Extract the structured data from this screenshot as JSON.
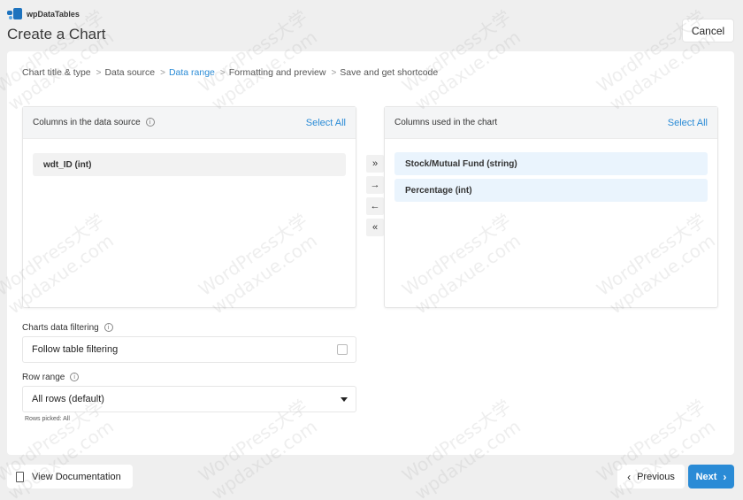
{
  "app": {
    "logo_text": "wpDataTables",
    "title": "Create a Chart"
  },
  "header": {
    "cancel_label": "Cancel"
  },
  "steps": [
    {
      "label": "Chart title & type"
    },
    {
      "label": "Data source"
    },
    {
      "label": "Data range"
    },
    {
      "label": "Formatting and preview"
    },
    {
      "label": "Save and get shortcode"
    }
  ],
  "active_step": "Data range",
  "source_panel": {
    "title": "Columns in the data source",
    "select_all": "Select All",
    "columns": [
      "wdt_ID (int)"
    ]
  },
  "chart_panel": {
    "title": "Columns used in the chart",
    "select_all": "Select All",
    "columns": [
      "Stock/Mutual Fund (string)",
      "Percentage (int)"
    ]
  },
  "transfer_buttons": {
    "add_all": "»",
    "add": "→",
    "remove": "←",
    "remove_all": "«"
  },
  "filtering": {
    "label": "Charts data filtering",
    "option": "Follow table filtering",
    "checked": false
  },
  "row_range": {
    "label": "Row range",
    "selected": "All rows (default)",
    "hint": "Rows picked: All"
  },
  "footer": {
    "doc_label": "View Documentation",
    "prev_label": "Previous",
    "next_label": "Next"
  },
  "watermark": {
    "line1": "WordPress大学",
    "line2": "wpdaxue.com"
  },
  "colors": {
    "accent": "#2a8bd6",
    "background": "#efefef",
    "selected_item": "#eaf4fd"
  }
}
